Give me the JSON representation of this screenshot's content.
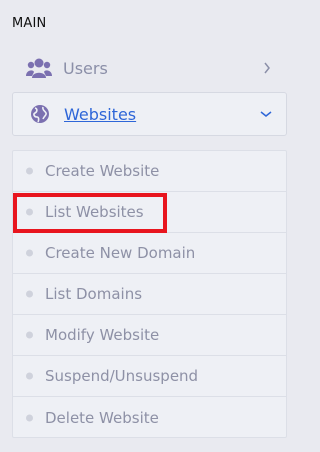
{
  "section": {
    "title": "MAIN"
  },
  "nav": [
    {
      "label": "Users",
      "icon": "users-icon",
      "chevron": "chevron-right-icon"
    },
    {
      "label": "Websites",
      "icon": "globe-icon",
      "chevron": "chevron-down-icon",
      "expanded": true
    }
  ],
  "submenu": {
    "items": [
      {
        "label": "Create Website"
      },
      {
        "label": "List Websites"
      },
      {
        "label": "Create New Domain"
      },
      {
        "label": "List Domains"
      },
      {
        "label": "Modify Website"
      },
      {
        "label": "Suspend/Unsuspend"
      },
      {
        "label": "Delete Website"
      }
    ]
  },
  "colors": {
    "background": "#e9eaf0",
    "icon": "#7b70b0",
    "link": "#2e66d8",
    "highlight": "#e8151e"
  }
}
